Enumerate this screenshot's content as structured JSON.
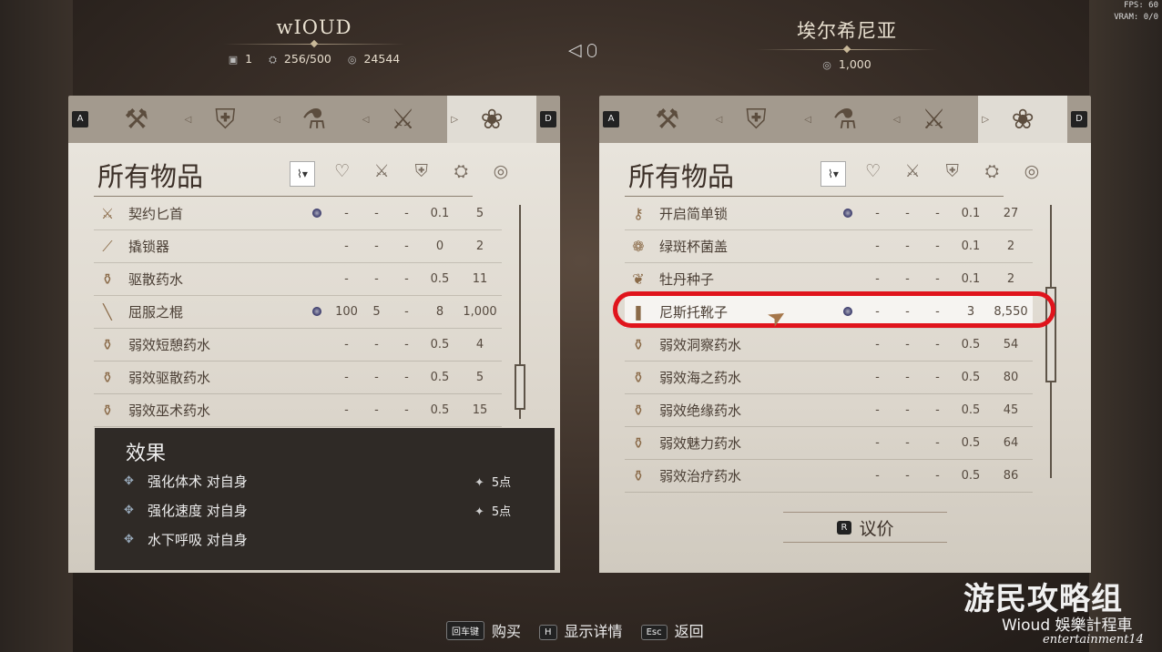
{
  "system": {
    "fps": "FPS: 60",
    "vram": "VRAM: 0/0"
  },
  "player": {
    "name": "wIOUD",
    "level": "1",
    "weight": "256/500",
    "money": "24544"
  },
  "merchant": {
    "name": "埃尔希尼亚",
    "money": "1,000"
  },
  "tab_keys": {
    "prev": "A",
    "next": "D"
  },
  "tab_icons": [
    "axe-icon",
    "shield-icon",
    "alchemy-icon",
    "tools-icon",
    "herb-icon"
  ],
  "left_panel": {
    "title": "所有物品",
    "items": [
      {
        "name": "契约匕首",
        "icon": "dagger-icon",
        "dot": true,
        "c1": "-",
        "c2": "-",
        "c3": "-",
        "weight": "0.1",
        "value": "5"
      },
      {
        "name": "撬锁器",
        "icon": "lockpick-icon",
        "dot": false,
        "c1": "-",
        "c2": "-",
        "c3": "-",
        "weight": "0",
        "value": "2"
      },
      {
        "name": "驱散药水",
        "icon": "potion-icon",
        "dot": false,
        "c1": "-",
        "c2": "-",
        "c3": "-",
        "weight": "0.5",
        "value": "11"
      },
      {
        "name": "屈服之棍",
        "icon": "staff-icon",
        "dot": true,
        "c1": "100",
        "c2": "5",
        "c3": "-",
        "weight": "8",
        "value": "1,000"
      },
      {
        "name": "弱效短憩药水",
        "icon": "potion-icon",
        "dot": false,
        "c1": "-",
        "c2": "-",
        "c3": "-",
        "weight": "0.5",
        "value": "4"
      },
      {
        "name": "弱效驱散药水",
        "icon": "potion-icon",
        "dot": false,
        "c1": "-",
        "c2": "-",
        "c3": "-",
        "weight": "0.5",
        "value": "5"
      },
      {
        "name": "弱效巫术药水",
        "icon": "potion-icon",
        "dot": false,
        "c1": "-",
        "c2": "-",
        "c3": "-",
        "weight": "0.5",
        "value": "15"
      }
    ]
  },
  "effects": {
    "title": "效果",
    "items": [
      {
        "text": "强化体术 对自身",
        "points": "5点"
      },
      {
        "text": "强化速度 对自身",
        "points": "5点"
      },
      {
        "text": "水下呼吸 对自身",
        "points": ""
      }
    ]
  },
  "right_panel": {
    "title": "所有物品",
    "items": [
      {
        "name": "开启简单锁",
        "icon": "key-icon",
        "dot": true,
        "c1": "-",
        "c2": "-",
        "c3": "-",
        "weight": "0.1",
        "value": "27"
      },
      {
        "name": "绿斑杯菌盖",
        "icon": "mushroom-icon",
        "dot": false,
        "c1": "-",
        "c2": "-",
        "c3": "-",
        "weight": "0.1",
        "value": "2"
      },
      {
        "name": "牡丹种子",
        "icon": "seed-icon",
        "dot": false,
        "c1": "-",
        "c2": "-",
        "c3": "-",
        "weight": "0.1",
        "value": "2"
      },
      {
        "name": "尼斯托靴子",
        "icon": "boots-icon",
        "dot": true,
        "c1": "-",
        "c2": "-",
        "c3": "-",
        "weight": "3",
        "value": "8,550",
        "highlight": true
      },
      {
        "name": "弱效洞察药水",
        "icon": "potion-icon",
        "dot": false,
        "c1": "-",
        "c2": "-",
        "c3": "-",
        "weight": "0.5",
        "value": "54"
      },
      {
        "name": "弱效海之药水",
        "icon": "potion-icon",
        "dot": false,
        "c1": "-",
        "c2": "-",
        "c3": "-",
        "weight": "0.5",
        "value": "80"
      },
      {
        "name": "弱效绝缘药水",
        "icon": "potion-icon",
        "dot": false,
        "c1": "-",
        "c2": "-",
        "c3": "-",
        "weight": "0.5",
        "value": "45"
      },
      {
        "name": "弱效魅力药水",
        "icon": "potion-icon",
        "dot": false,
        "c1": "-",
        "c2": "-",
        "c3": "-",
        "weight": "0.5",
        "value": "64"
      },
      {
        "name": "弱效治疗药水",
        "icon": "potion-icon",
        "dot": false,
        "c1": "-",
        "c2": "-",
        "c3": "-",
        "weight": "0.5",
        "value": "86"
      }
    ]
  },
  "bargain": {
    "key": "R",
    "label": "议价"
  },
  "footer": [
    {
      "key": "回车键",
      "label": "购买"
    },
    {
      "key": "H",
      "label": "显示详情"
    },
    {
      "key": "Esc",
      "label": "返回"
    }
  ],
  "watermark": {
    "main": "游民攻略组",
    "sub": "Wioud 娛樂計程車",
    "sub2": "entertainment14"
  }
}
